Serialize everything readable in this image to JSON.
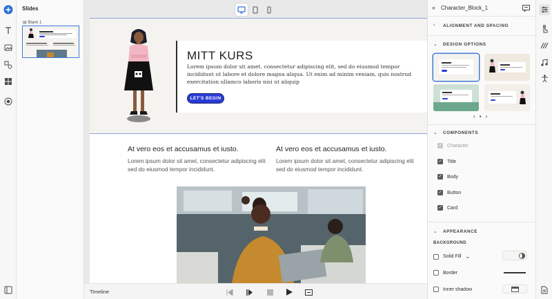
{
  "slides_panel": {
    "title": "Slides",
    "slide_label": "Blank 1"
  },
  "device_bar": {
    "icons": [
      "desktop-icon",
      "tablet-icon",
      "mobile-icon"
    ],
    "selected": "desktop"
  },
  "hero": {
    "title": "MITT KURS",
    "body": "Lorem ipsum dolor sit amet, consectetur adipiscing elit, sed do eiusmod tempor incididunt ut labore et dolore magna aliqua. Ut enim ad minim veniam, quis nostrud exercitation ullamco laboris nisi ut aliquip",
    "button_label": "LET'S BEGIN"
  },
  "columns": [
    {
      "heading": "At vero eos et accusamus et iusto.",
      "text": "Lorem ipsum dolor sit amet, consectetur adipiscing elit sed do eiusmod tempor incididunt."
    },
    {
      "heading": "At vero eos et accusamus et iusto.",
      "text": "Lorem ipsum dolor sit amet, consectetur adipiscing elit sed do eiusmod tempor incididunt."
    }
  ],
  "timeline": {
    "label": "Timeline"
  },
  "properties": {
    "block_name": "Character_Block_1",
    "sections": {
      "alignment": "ALIGNMENT AND SPACING",
      "design": "DESIGN OPTIONS",
      "components": "COMPONENTS",
      "appearance": "APPEARANCE"
    },
    "design_nav": {
      "prev": "‹",
      "dot": "●",
      "next": "›"
    },
    "components": [
      {
        "label": "Character",
        "checked": true,
        "disabled": true
      },
      {
        "label": "Title",
        "checked": true,
        "disabled": false
      },
      {
        "label": "Body",
        "checked": true,
        "disabled": false
      },
      {
        "label": "Button",
        "checked": true,
        "disabled": false
      },
      {
        "label": "Card",
        "checked": true,
        "disabled": false
      }
    ],
    "appearance": {
      "background_label": "BACKGROUND",
      "solid_fill": "Solid Fill",
      "border": "Border",
      "inner_shadow": "Inner shadow"
    }
  },
  "colors": {
    "accent": "#3e7bd6",
    "button": "#2a3bd6",
    "hero_bg": "#f5f3ef"
  }
}
